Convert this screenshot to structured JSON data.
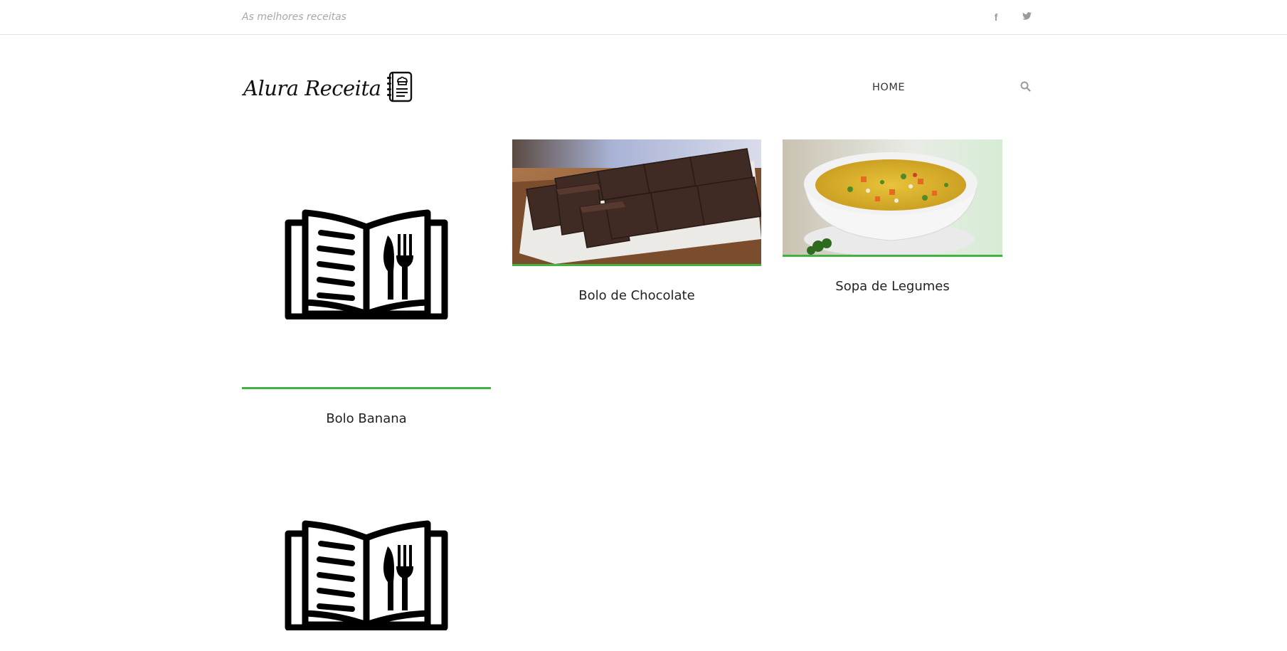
{
  "header": {
    "tagline": "As melhores receitas",
    "social": [
      {
        "name": "facebook-icon",
        "glyph": "f"
      },
      {
        "name": "twitter-icon",
        "glyph": "twitter"
      }
    ]
  },
  "logo": {
    "text": "Alura Receita",
    "icon": "recipe-notebook-icon"
  },
  "nav": {
    "home_label": "HOME",
    "search_icon": "search-icon"
  },
  "accent_color": "#42b341",
  "recipes": [
    {
      "title": "Bolo Banana",
      "image": "recipe-book-icon"
    },
    {
      "title": "Bolo de Chocolate",
      "image": "chocolate-cake-photo"
    },
    {
      "title": "Sopa de Legumes",
      "image": "vegetable-soup-photo"
    },
    {
      "title": "",
      "image": "recipe-book-icon"
    }
  ]
}
